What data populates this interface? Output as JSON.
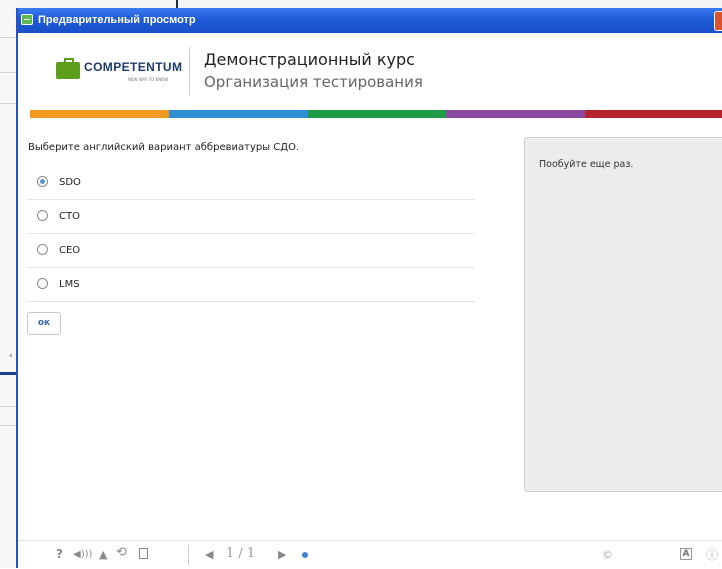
{
  "window": {
    "title": "Предварительный просмотр"
  },
  "header": {
    "logo_text": "COMPETENTUM",
    "logo_tagline": "NEW WAY TO KNOW",
    "course_title": "Демонстрационный курс",
    "section_title": "Организация тестирования",
    "stripe_colors": [
      "#f29a1d",
      "#2f8fd0",
      "#1f9a45",
      "#8b4aa2",
      "#b5232d"
    ]
  },
  "question": {
    "text": "Выберите английский вариант аббревиатуры СДО.",
    "options": [
      {
        "label": "SDO",
        "selected": true
      },
      {
        "label": "CTO",
        "selected": false
      },
      {
        "label": "CEO",
        "selected": false
      },
      {
        "label": "LMS",
        "selected": false
      }
    ],
    "ok_label": "ок"
  },
  "feedback": {
    "text": "Пообуйте еще раз."
  },
  "toolbar": {
    "help_icon": "?",
    "volume_icon": "◀)))",
    "up_icon": "▲",
    "reload_icon": "⟲",
    "prev_icon": "◀",
    "page_counter": "1 / 1",
    "next_icon": "▶",
    "copyright_icon": "©",
    "accessibility_icon": "A",
    "info_icon": "ⓘ"
  }
}
